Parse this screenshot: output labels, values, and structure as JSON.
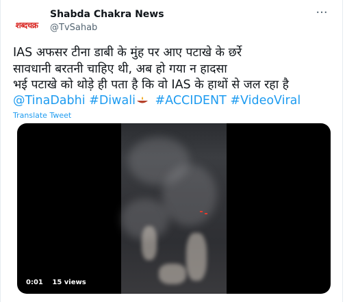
{
  "account": {
    "name": "Shabda Chakra News",
    "handle": "@TvSahab",
    "avatar_text": "शब्दचक्र"
  },
  "more_icon": "more-icon",
  "tweet": {
    "lines": [
      "IAS अफसर टीना डाबी के मुंह पर आए पटाखे के छर्रे",
      "सावधानी बरतनी चाहिए थी, अब हो गया न हादसा",
      "भई पटाखे को थोड़े ही पता है कि वो IAS के हाथों से जल रहा है"
    ],
    "tags": [
      "@TinaDabhi",
      "#Diwali",
      "#ACCIDENT",
      "#VideoViral"
    ],
    "translate": "Translate Tweet"
  },
  "video": {
    "time": "0:01",
    "views": "15 views"
  },
  "colors": {
    "link": "#1d9bf0",
    "text": "#0f1419",
    "muted": "#536471"
  }
}
